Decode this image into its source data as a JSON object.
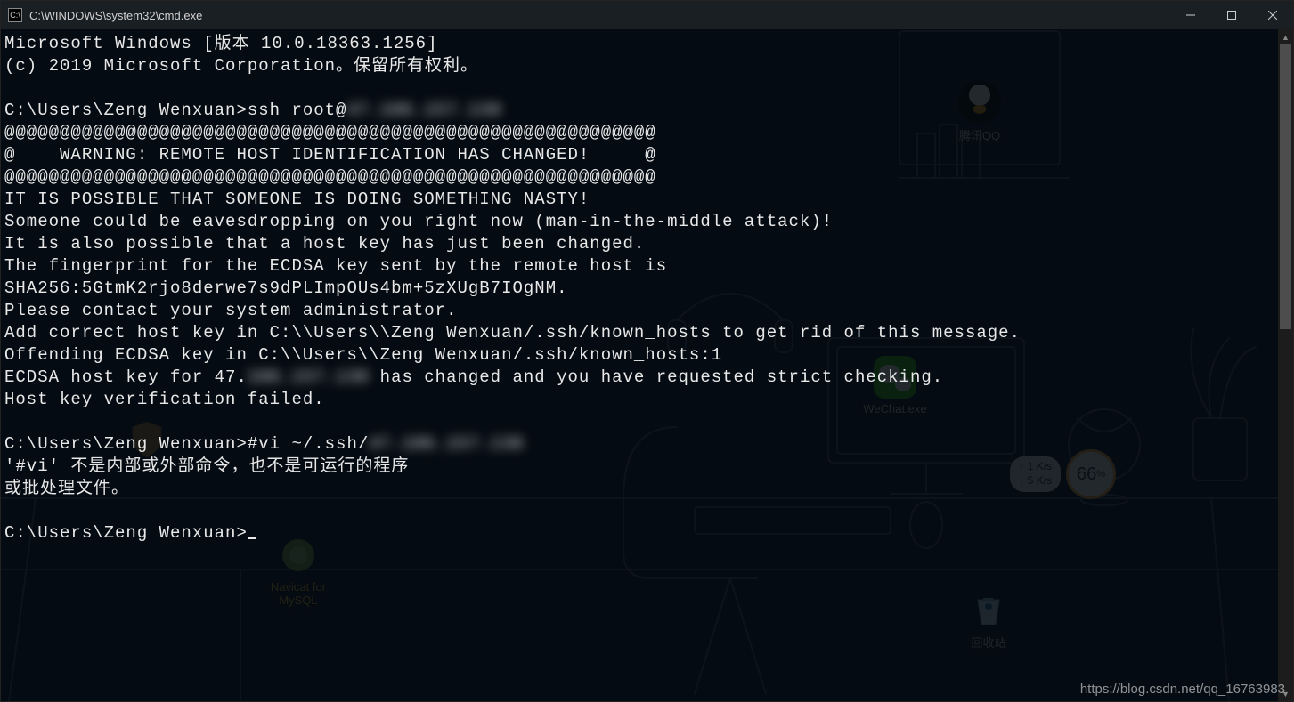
{
  "window": {
    "title": "C:\\WINDOWS\\system32\\cmd.exe",
    "icon_label": "C:\\"
  },
  "terminal": {
    "lines": [
      "Microsoft Windows [版本 10.0.18363.1256]",
      "(c) 2019 Microsoft Corporation。保留所有权利。",
      "",
      "C:\\Users\\Zeng Wenxuan>ssh root@",
      "@@@@@@@@@@@@@@@@@@@@@@@@@@@@@@@@@@@@@@@@@@@@@@@@@@@@@@@@@@@",
      "@    WARNING: REMOTE HOST IDENTIFICATION HAS CHANGED!     @",
      "@@@@@@@@@@@@@@@@@@@@@@@@@@@@@@@@@@@@@@@@@@@@@@@@@@@@@@@@@@@",
      "IT IS POSSIBLE THAT SOMEONE IS DOING SOMETHING NASTY!",
      "Someone could be eavesdropping on you right now (man-in-the-middle attack)!",
      "It is also possible that a host key has just been changed.",
      "The fingerprint for the ECDSA key sent by the remote host is",
      "SHA256:5GtmK2rjo8derwe7s9dPLImpOUs4bm+5zXUgB7IOgNM.",
      "Please contact your system administrator.",
      "Add correct host key in C:\\\\Users\\\\Zeng Wenxuan/.ssh/known_hosts to get rid of this message.",
      "Offending ECDSA key in C:\\\\Users\\\\Zeng Wenxuan/.ssh/known_hosts:1",
      "ECDSA host key for 47.",
      "Host key verification failed.",
      "",
      "C:\\Users\\Zeng Wenxuan>#vi ~/.ssh/",
      "'#vi' 不是内部或外部命令，也不是可运行的程序",
      "或批处理文件。",
      "",
      "C:\\Users\\Zeng Wenxuan>"
    ],
    "blur_after_line3": "47.106.157.130",
    "blur_after_line15": "106.157.130",
    "rest_line15": " has changed and you have requested strict checking.",
    "blur_after_line18": "47.106.157.130"
  },
  "desktop_icons": {
    "qq": "腾讯QQ",
    "wechat": "WeChat.exe",
    "recycle": "回收站",
    "navicat": "Navicat for\nMySQL"
  },
  "netwidget": {
    "up": "1  K/s",
    "down": "5  K/s",
    "percent": "66",
    "percent_suffix": "%"
  },
  "watermark": "https://blog.csdn.net/qq_16763983"
}
